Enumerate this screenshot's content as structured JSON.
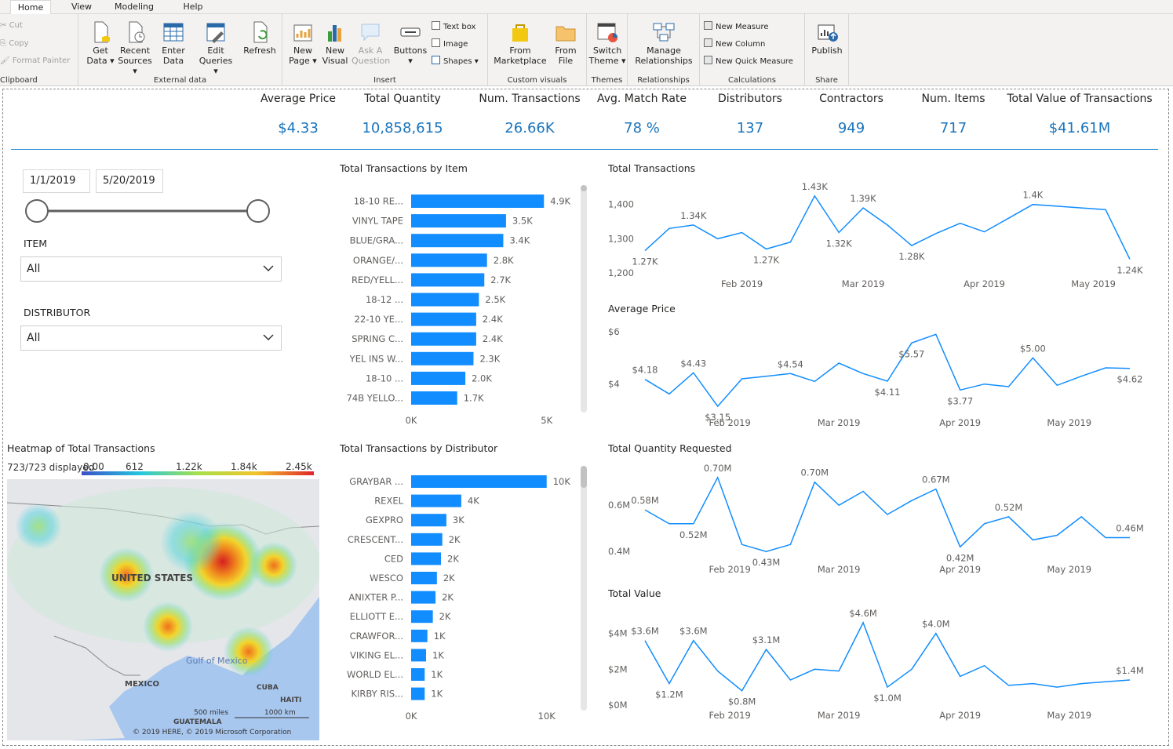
{
  "ribbon": {
    "tabs": [
      "Home",
      "View",
      "Modeling",
      "Help"
    ],
    "clipboard": {
      "cut": "Cut",
      "copy": "Copy",
      "format_painter": "Format Painter",
      "group": "Clipboard"
    },
    "external_data": {
      "get_data": [
        "Get",
        "Data ▾"
      ],
      "recent_sources": [
        "Recent",
        "Sources ▾"
      ],
      "enter_data": [
        "Enter",
        "Data"
      ],
      "edit_queries": [
        "Edit",
        "Queries ▾"
      ],
      "refresh": "Refresh",
      "group": "External data"
    },
    "insert": {
      "new_page": [
        "New",
        "Page ▾"
      ],
      "new_visual": [
        "New",
        "Visual"
      ],
      "ask_question": [
        "Ask A",
        "Question"
      ],
      "buttons": [
        "Buttons",
        "▾"
      ],
      "text_box": "Text box",
      "image": "Image",
      "shapes": "Shapes ▾",
      "group": "Insert"
    },
    "custom_visuals": {
      "from_marketplace": [
        "From",
        "Marketplace"
      ],
      "from_file": [
        "From",
        "File"
      ],
      "group": "Custom visuals"
    },
    "themes": {
      "switch_theme": [
        "Switch",
        "Theme ▾"
      ],
      "group": "Themes"
    },
    "relationships": {
      "manage": [
        "Manage",
        "Relationships"
      ],
      "group": "Relationships"
    },
    "calculations": {
      "new_measure": "New Measure",
      "new_column": "New Column",
      "new_quick_measure": "New Quick Measure",
      "group": "Calculations"
    },
    "share": {
      "publish": "Publish",
      "group": "Share"
    }
  },
  "kpis": [
    {
      "label": "Average Price",
      "value": "$4.33"
    },
    {
      "label": "Total Quantity",
      "value": "10,858,615"
    },
    {
      "label": "Num. Transactions",
      "value": "26.66K"
    },
    {
      "label": "Avg. Match Rate",
      "value": "78 %"
    },
    {
      "label": "Distributors",
      "value": "137"
    },
    {
      "label": "Contractors",
      "value": "949"
    },
    {
      "label": "Num. Items",
      "value": "717"
    },
    {
      "label": "Total Value of Transactions",
      "value": "$41.61M"
    }
  ],
  "slicers": {
    "date_start": "1/1/2019",
    "date_end": "5/20/2019",
    "item_label": "ITEM",
    "item_value": "All",
    "distributor_label": "DISTRIBUTOR",
    "distributor_value": "All"
  },
  "map": {
    "title": "Heatmap of Total Transactions",
    "displayed": "723/723 displayed",
    "legend_ticks": [
      "0.00",
      "612",
      "1.22k",
      "1.84k",
      "2.45k"
    ],
    "labels": {
      "us": "UNITED STATES",
      "gulf": "Gulf of Mexico",
      "mexico": "MEXICO",
      "cuba": "CUBA",
      "haiti": "HAITI",
      "guatemala": "GUATEMALA"
    },
    "scale_miles": "500 miles",
    "scale_km": "1000 km",
    "copyright": "© 2019 HERE, © 2019 Microsoft Corporation"
  },
  "chart_data": [
    {
      "type": "bar",
      "orientation": "horizontal",
      "title": "Total Transactions by Item",
      "categories": [
        "18-10 RE...",
        "VINYL TAPE",
        "BLUE/GRA...",
        "ORANGE/...",
        "RED/YELL...",
        "18-12 ...",
        "22-10 YE...",
        "SPRING C...",
        "YEL INS W...",
        "18-10 ...",
        "74B YELLO..."
      ],
      "values": [
        4900,
        3500,
        3400,
        2800,
        2700,
        2500,
        2400,
        2400,
        2300,
        2000,
        1700
      ],
      "value_labels": [
        "4.9K",
        "3.5K",
        "3.4K",
        "2.8K",
        "2.7K",
        "2.5K",
        "2.4K",
        "2.4K",
        "2.3K",
        "2.0K",
        "1.7K"
      ],
      "xticks": [
        "0K",
        "5K"
      ],
      "xlim": [
        0,
        5500
      ],
      "color": "#118dff"
    },
    {
      "type": "bar",
      "orientation": "horizontal",
      "title": "Total Transactions by Distributor",
      "categories": [
        "GRAYBAR ...",
        "REXEL",
        "GEXPRO",
        "CRESCENT...",
        "CED",
        "WESCO",
        "ANIXTER P...",
        "ELLIOTT E...",
        "CRAWFOR...",
        "VIKING EL...",
        "WORLD EL...",
        "KIRBY RIS..."
      ],
      "values": [
        10000,
        3700,
        2600,
        2300,
        2200,
        1900,
        1800,
        1600,
        1200,
        1100,
        1000,
        1000
      ],
      "value_labels": [
        "10K",
        "4K",
        "3K",
        "2K",
        "2K",
        "2K",
        "2K",
        "2K",
        "1K",
        "1K",
        "1K",
        "1K"
      ],
      "xticks": [
        "0K",
        "10K"
      ],
      "xlim": [
        0,
        11000
      ],
      "color": "#118dff"
    },
    {
      "type": "line",
      "title": "Total Transactions",
      "x": [
        1,
        2,
        3,
        4,
        5,
        6,
        7,
        8,
        9,
        10,
        11,
        12,
        13,
        14,
        15,
        16,
        17,
        18,
        19,
        20,
        21
      ],
      "y": [
        1265,
        1330,
        1340,
        1300,
        1318,
        1270,
        1290,
        1425,
        1318,
        1390,
        1340,
        1280,
        1315,
        1345,
        1320,
        1360,
        1400,
        1395,
        1390,
        1385,
        1240
      ],
      "data_labels": [
        {
          "i": 0,
          "text": "1.27K"
        },
        {
          "i": 2,
          "text": "1.34K"
        },
        {
          "i": 5,
          "text": "1.27K"
        },
        {
          "i": 7,
          "text": "1.43K"
        },
        {
          "i": 8,
          "text": "1.32K"
        },
        {
          "i": 9,
          "text": "1.39K"
        },
        {
          "i": 11,
          "text": "1.28K"
        },
        {
          "i": 16,
          "text": "1.4K"
        },
        {
          "i": 20,
          "text": "1.24K"
        }
      ],
      "yticks": [
        "1,400",
        "1,300",
        "1,200"
      ],
      "ytick_values": [
        1400,
        1300,
        1200
      ],
      "ylim": [
        1200,
        1420
      ],
      "xticks": [
        {
          "x": 5,
          "label": "Feb 2019"
        },
        {
          "x": 10,
          "label": "Mar 2019"
        },
        {
          "x": 15,
          "label": "Apr 2019"
        },
        {
          "x": 19.5,
          "label": "May 2019"
        }
      ],
      "color": "#118dff"
    },
    {
      "type": "line",
      "title": "Average Price",
      "x": [
        1,
        2,
        3,
        4,
        5,
        6,
        7,
        8,
        9,
        10,
        11,
        12,
        13,
        14,
        15,
        16,
        17,
        18,
        19,
        20,
        21
      ],
      "y": [
        4.18,
        3.62,
        4.43,
        3.15,
        4.2,
        4.3,
        4.4,
        4.1,
        4.8,
        4.4,
        4.11,
        5.57,
        5.9,
        3.77,
        4.0,
        3.9,
        5.0,
        3.95,
        4.3,
        4.62,
        4.6
      ],
      "data_labels": [
        {
          "i": 0,
          "text": "$4.18"
        },
        {
          "i": 2,
          "text": "$4.43"
        },
        {
          "i": 3,
          "text": "$3.15"
        },
        {
          "i": 6,
          "text": "$4.54"
        },
        {
          "i": 10,
          "text": "$4.11"
        },
        {
          "i": 11,
          "text": "$5.57"
        },
        {
          "i": 13,
          "text": "$3.77"
        },
        {
          "i": 16,
          "text": "$5.00"
        },
        {
          "i": 20,
          "text": "$4.62"
        }
      ],
      "yticks": [
        "$6",
        "$4"
      ],
      "ytick_values": [
        6,
        4
      ],
      "ylim": [
        3,
        6.3
      ],
      "xticks": [
        {
          "x": 4.5,
          "label": "Feb 2019"
        },
        {
          "x": 9,
          "label": "Mar 2019"
        },
        {
          "x": 14,
          "label": "Apr 2019"
        },
        {
          "x": 18.5,
          "label": "May 2019"
        }
      ],
      "color": "#118dff"
    },
    {
      "type": "line",
      "title": "Total Quantity Requested",
      "x": [
        1,
        2,
        3,
        4,
        5,
        6,
        7,
        8,
        9,
        10,
        11,
        12,
        13,
        14,
        15,
        16,
        17,
        18,
        19,
        20,
        21
      ],
      "y": [
        0.58,
        0.52,
        0.52,
        0.72,
        0.43,
        0.4,
        0.43,
        0.7,
        0.6,
        0.66,
        0.56,
        0.62,
        0.67,
        0.42,
        0.52,
        0.55,
        0.45,
        0.47,
        0.55,
        0.46,
        0.46
      ],
      "data_labels": [
        {
          "i": 0,
          "text": "0.58M"
        },
        {
          "i": 2,
          "text": "0.52M"
        },
        {
          "i": 3,
          "text": "0.70M"
        },
        {
          "i": 5,
          "text": "0.43M"
        },
        {
          "i": 7,
          "text": "0.70M"
        },
        {
          "i": 12,
          "text": "0.67M"
        },
        {
          "i": 13,
          "text": "0.42M"
        },
        {
          "i": 15,
          "text": "0.52M"
        },
        {
          "i": 20,
          "text": "0.46M"
        }
      ],
      "yticks": [
        "0.6M",
        "0.4M"
      ],
      "ytick_values": [
        0.6,
        0.4
      ],
      "ylim": [
        0.37,
        0.75
      ],
      "xticks": [
        {
          "x": 4.5,
          "label": "Feb 2019"
        },
        {
          "x": 9,
          "label": "Mar 2019"
        },
        {
          "x": 14,
          "label": "Apr 2019"
        },
        {
          "x": 18.5,
          "label": "May 2019"
        }
      ],
      "color": "#118dff"
    },
    {
      "type": "line",
      "title": "Total Value",
      "x": [
        1,
        2,
        3,
        4,
        5,
        6,
        7,
        8,
        9,
        10,
        11,
        12,
        13,
        14,
        15,
        16,
        17,
        18,
        19,
        20,
        21
      ],
      "y": [
        3.6,
        1.2,
        3.6,
        1.9,
        0.8,
        3.1,
        1.4,
        2.0,
        1.9,
        4.6,
        1.0,
        2.0,
        4.0,
        1.6,
        2.2,
        1.1,
        1.2,
        1.0,
        1.2,
        1.3,
        1.4
      ],
      "data_labels": [
        {
          "i": 0,
          "text": "$3.6M"
        },
        {
          "i": 1,
          "text": "$1.2M"
        },
        {
          "i": 2,
          "text": "$3.6M"
        },
        {
          "i": 4,
          "text": "$0.8M"
        },
        {
          "i": 5,
          "text": "$3.1M"
        },
        {
          "i": 9,
          "text": "$4.6M"
        },
        {
          "i": 10,
          "text": "$1.0M"
        },
        {
          "i": 12,
          "text": "$4.0M"
        },
        {
          "i": 20,
          "text": "$1.4M"
        }
      ],
      "yticks": [
        "$4M",
        "$2M",
        "$0M"
      ],
      "ytick_values": [
        4,
        2,
        0
      ],
      "ylim": [
        0,
        4.9
      ],
      "xticks": [
        {
          "x": 4.5,
          "label": "Feb 2019"
        },
        {
          "x": 9,
          "label": "Mar 2019"
        },
        {
          "x": 14,
          "label": "Apr 2019"
        },
        {
          "x": 18.5,
          "label": "May 2019"
        }
      ],
      "color": "#118dff"
    }
  ]
}
